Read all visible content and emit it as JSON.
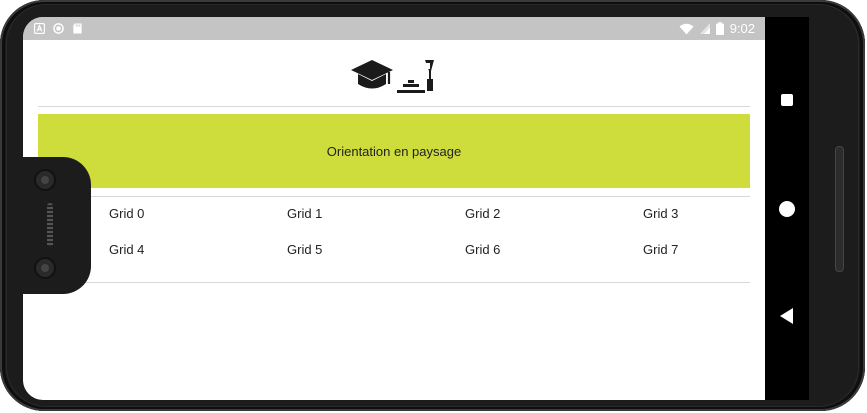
{
  "status_bar": {
    "time": "9:02",
    "left_icons": [
      "android-notification-icon",
      "circle-notification-icon",
      "sd-card-icon"
    ],
    "right_icons": [
      "wifi-icon",
      "signal-icon",
      "battery-icon"
    ]
  },
  "header": {
    "logo_icons": [
      "graduation-cap-icon",
      "bench-tool-icon"
    ]
  },
  "banner": {
    "text": "Orientation en paysage",
    "color": "#cfdd3c"
  },
  "grid": {
    "cells": [
      "Grid 0",
      "Grid 1",
      "Grid 2",
      "Grid 3",
      "Grid 4",
      "Grid 5",
      "Grid 6",
      "Grid 7"
    ]
  },
  "nav_bar": {
    "buttons": [
      "recents-button",
      "home-button",
      "back-button"
    ]
  }
}
